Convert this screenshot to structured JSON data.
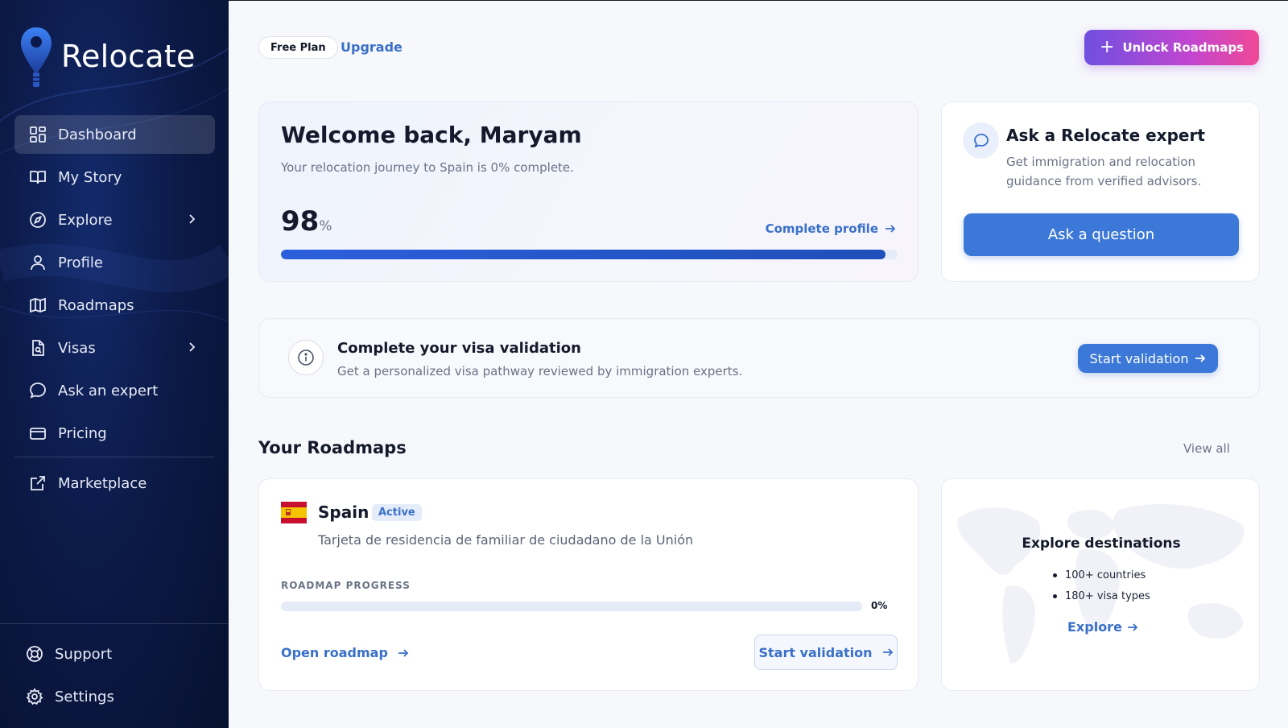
{
  "brand": {
    "name": "Relocate"
  },
  "sidebar": {
    "items": [
      {
        "label": "Dashboard",
        "icon": "dashboard-icon",
        "active": true
      },
      {
        "label": "My Story",
        "icon": "book-icon"
      },
      {
        "label": "Explore",
        "icon": "compass-icon",
        "has_submenu": true
      },
      {
        "label": "Profile",
        "icon": "user-icon"
      },
      {
        "label": "Roadmaps",
        "icon": "map-icon"
      },
      {
        "label": "Visas",
        "icon": "document-search-icon",
        "has_submenu": true
      },
      {
        "label": "Ask an expert",
        "icon": "chat-icon"
      },
      {
        "label": "Pricing",
        "icon": "credit-card-icon"
      },
      {
        "label": "Marketplace",
        "icon": "external-link-icon"
      }
    ],
    "bottom": [
      {
        "label": "Support",
        "icon": "lifebuoy-icon"
      },
      {
        "label": "Settings",
        "icon": "gear-icon"
      }
    ]
  },
  "header": {
    "plan": "Free Plan",
    "upgrade": "Upgrade",
    "unlock": "Unlock Roadmaps"
  },
  "welcome": {
    "title": "Welcome back, Maryam",
    "subtitle": "Your relocation journey to Spain is 0% complete.",
    "percent": "98",
    "percent_unit": "%",
    "progress": 0.98,
    "complete_link": "Complete profile"
  },
  "expert": {
    "title": "Ask a Relocate expert",
    "description": "Get immigration and relocation guidance from verified advisors.",
    "button": "Ask a question"
  },
  "visa_banner": {
    "title": "Complete your visa validation",
    "description": "Get a personalized visa pathway reviewed by immigration experts.",
    "button": "Start validation"
  },
  "roadmaps": {
    "title": "Your Roadmaps",
    "view_all": "View all",
    "items": [
      {
        "country": "Spain",
        "status": "Active",
        "description": "Tarjeta de residencia de familiar de ciudadano de la Unión",
        "progress_label": "ROADMAP PROGRESS",
        "progress_value": "0%",
        "progress": 0,
        "open_link": "Open roadmap",
        "validate_button": "Start validation"
      }
    ]
  },
  "destinations": {
    "title": "Explore destinations",
    "points": [
      "100+ countries",
      "180+ visa types"
    ],
    "link": "Explore"
  },
  "colors": {
    "accent": "#3c78d8",
    "link": "#3a70c9",
    "sidebar_bg": "#0c1a48",
    "gradient_start": "#6f4fe0",
    "gradient_end": "#f04896"
  }
}
